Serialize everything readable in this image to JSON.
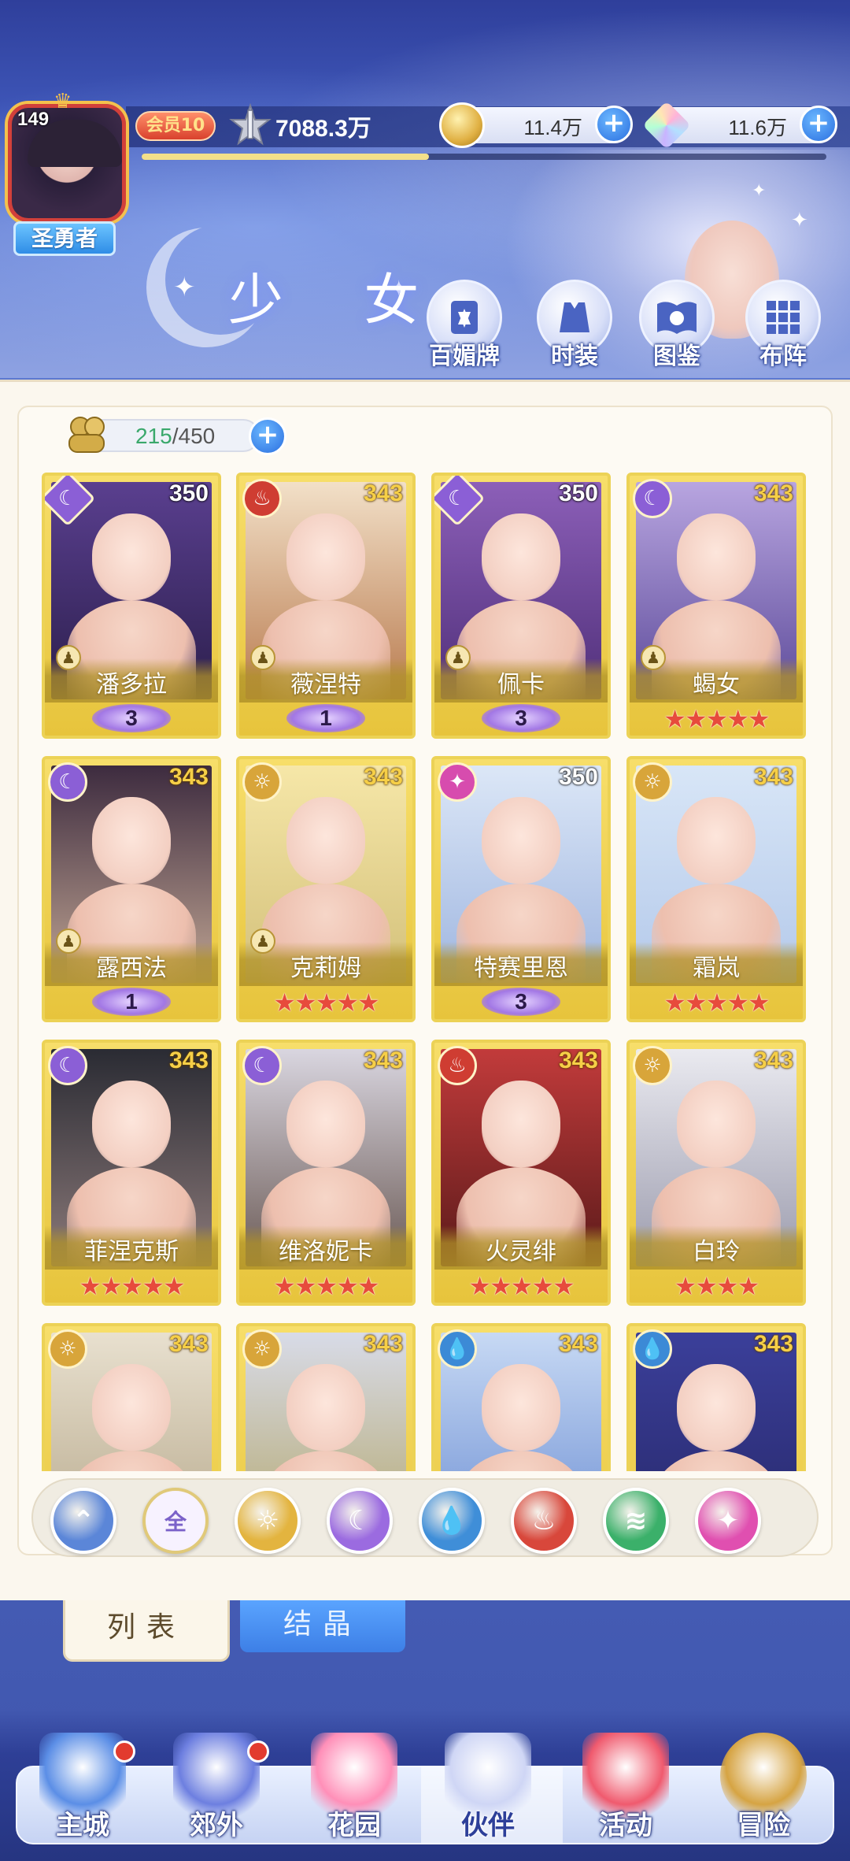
{
  "player": {
    "level": "149",
    "title": "圣勇者",
    "vip": "会员10",
    "power": "7088.3万",
    "xp_fraction": 0.42
  },
  "currencies": [
    {
      "name": "gold-coin",
      "value": "11.4万"
    },
    {
      "name": "crystal",
      "value": "11.6万"
    }
  ],
  "page_title": "少 女",
  "top_menu": [
    {
      "label": "百媚牌",
      "icon": "card-icon"
    },
    {
      "label": "时装",
      "icon": "fashion-icon"
    },
    {
      "label": "图鉴",
      "icon": "book-icon"
    },
    {
      "label": "布阵",
      "icon": "formation-icon"
    }
  ],
  "capacity": {
    "current": "215",
    "max": "/450"
  },
  "cards": [
    {
      "name": "潘多拉",
      "level": "350",
      "element": "moon",
      "badge": "diamond",
      "rank_type": "wing",
      "rank": "3",
      "pawn": true
    },
    {
      "name": "薇涅特",
      "level": "343",
      "element": "fire",
      "badge": "circle",
      "rank_type": "wing",
      "rank": "1",
      "pawn": true
    },
    {
      "name": "佩卡",
      "level": "350",
      "element": "moon",
      "badge": "diamond",
      "rank_type": "wing",
      "rank": "3",
      "pawn": true
    },
    {
      "name": "蝎女",
      "level": "343",
      "element": "moon",
      "badge": "circle",
      "rank_type": "stars",
      "rank": "★★★★★",
      "pawn": true
    },
    {
      "name": "露西法",
      "level": "343",
      "element": "moon",
      "badge": "circle",
      "rank_type": "wing",
      "rank": "1",
      "pawn": true
    },
    {
      "name": "克莉姆",
      "level": "343",
      "element": "light",
      "badge": "circle",
      "rank_type": "stars",
      "rank": "★★★★★",
      "pawn": true
    },
    {
      "name": "特赛里恩",
      "level": "350",
      "element": "star",
      "badge": "circle",
      "rank_type": "wing",
      "rank": "3",
      "pawn": false
    },
    {
      "name": "霜岚",
      "level": "343",
      "element": "light",
      "badge": "circle",
      "rank_type": "stars",
      "rank": "★★★★★",
      "pawn": false
    },
    {
      "name": "菲涅克斯",
      "level": "343",
      "element": "moon",
      "badge": "circle",
      "rank_type": "stars",
      "rank": "★★★★★",
      "pawn": false
    },
    {
      "name": "维洛妮卡",
      "level": "343",
      "element": "moon",
      "badge": "circle",
      "rank_type": "stars",
      "rank": "★★★★★",
      "pawn": false
    },
    {
      "name": "火灵绯",
      "level": "343",
      "element": "fire",
      "badge": "circle",
      "rank_type": "stars",
      "rank": "★★★★★",
      "pawn": false
    },
    {
      "name": "白玲",
      "level": "343",
      "element": "light",
      "badge": "circle",
      "rank_type": "stars",
      "rank": "★★★★",
      "pawn": false
    },
    {
      "name": "",
      "level": "343",
      "element": "light",
      "badge": "circle",
      "rank_type": "none",
      "rank": "",
      "pawn": false
    },
    {
      "name": "",
      "level": "343",
      "element": "light",
      "badge": "circle",
      "rank_type": "none",
      "rank": "",
      "pawn": false
    },
    {
      "name": "",
      "level": "343",
      "element": "water",
      "badge": "circle",
      "rank_type": "none",
      "rank": "",
      "pawn": false
    },
    {
      "name": "",
      "level": "343",
      "element": "water",
      "badge": "circle",
      "rank_type": "none",
      "rank": "",
      "pawn": false
    }
  ],
  "filters": [
    {
      "name": "collapse-filter-icon",
      "glyph": "⌃",
      "color": "#5b86d8"
    },
    {
      "name": "all-filter",
      "glyph": "全",
      "color": "#f7f2ff"
    },
    {
      "name": "light-filter-icon",
      "glyph": "☼",
      "color": "#e3b43f"
    },
    {
      "name": "moon-filter-icon",
      "glyph": "☾",
      "color": "#9b6be0"
    },
    {
      "name": "water-filter-icon",
      "glyph": "💧",
      "color": "#3f8ed8"
    },
    {
      "name": "fire-filter-icon",
      "glyph": "♨",
      "color": "#d8473b"
    },
    {
      "name": "wind-filter-icon",
      "glyph": "≋",
      "color": "#3bb06a"
    },
    {
      "name": "star-filter-icon",
      "glyph": "✦",
      "color": "#e04fb0"
    }
  ],
  "tabs": {
    "list": "列表",
    "crystal": "结晶"
  },
  "nav": [
    {
      "label": "主城",
      "icon": "castle-icon",
      "dot": true
    },
    {
      "label": "郊外",
      "icon": "portal-icon",
      "dot": true
    },
    {
      "label": "花园",
      "icon": "heart-icon",
      "dot": false
    },
    {
      "label": "伙伴",
      "icon": "partner-icon",
      "dot": false,
      "active": true
    },
    {
      "label": "活动",
      "icon": "gift-icon",
      "dot": false
    },
    {
      "label": "冒险",
      "icon": "compass-icon",
      "dot": false
    }
  ],
  "colors": {
    "element_moon": "#8b5fd6",
    "element_fire": "#cf3d32",
    "element_light": "#d8a53a",
    "element_water": "#3c8ad6",
    "element_star": "#d74cae",
    "card_gold": "#ecd256",
    "accent_blue": "#2f7ae6"
  }
}
